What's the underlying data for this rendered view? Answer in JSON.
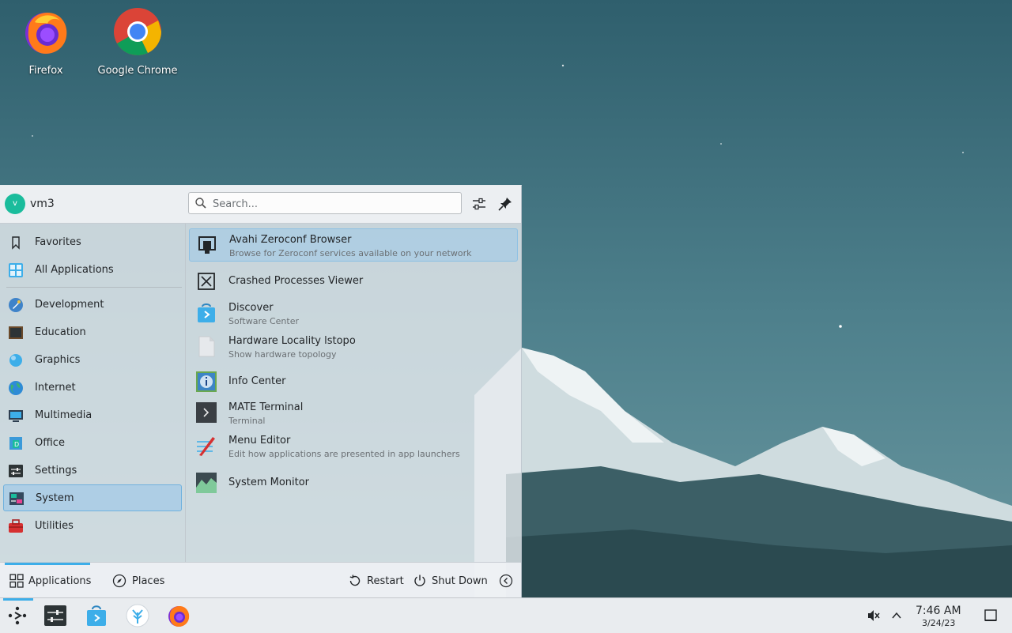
{
  "desktop": {
    "icons": [
      {
        "label": "Firefox"
      },
      {
        "label": "Google Chrome"
      }
    ]
  },
  "launcher": {
    "user": {
      "avatar_letter": "v",
      "name": "vm3"
    },
    "search": {
      "placeholder": "Search..."
    },
    "categories": [
      {
        "label": "Favorites",
        "icon": "bookmark-icon"
      },
      {
        "label": "All Applications",
        "icon": "grid-icon"
      },
      {
        "label": "Development",
        "icon": "development-icon"
      },
      {
        "label": "Education",
        "icon": "education-icon"
      },
      {
        "label": "Graphics",
        "icon": "graphics-icon"
      },
      {
        "label": "Internet",
        "icon": "internet-icon"
      },
      {
        "label": "Multimedia",
        "icon": "multimedia-icon"
      },
      {
        "label": "Office",
        "icon": "office-icon"
      },
      {
        "label": "Settings",
        "icon": "settings-icon"
      },
      {
        "label": "System",
        "icon": "system-icon"
      },
      {
        "label": "Utilities",
        "icon": "utilities-icon"
      }
    ],
    "selected_category": "System",
    "apps": [
      {
        "name": "Avahi Zeroconf Browser",
        "description": "Browse for Zeroconf services available on your network"
      },
      {
        "name": "Crashed Processes Viewer",
        "description": ""
      },
      {
        "name": "Discover",
        "description": "Software Center"
      },
      {
        "name": "Hardware Locality lstopo",
        "description": "Show hardware topology"
      },
      {
        "name": "Info Center",
        "description": ""
      },
      {
        "name": "MATE Terminal",
        "description": "Terminal"
      },
      {
        "name": "Menu Editor",
        "description": "Edit how applications are presented in app launchers"
      },
      {
        "name": "System Monitor",
        "description": ""
      }
    ],
    "footer": {
      "applications_label": "Applications",
      "places_label": "Places",
      "restart_label": "Restart",
      "shutdown_label": "Shut Down"
    }
  },
  "taskbar": {
    "clock": {
      "time": "7:46 AM",
      "date": "3/24/23"
    }
  },
  "colors": {
    "accent": "#3daee9",
    "selection": "#9cc8e8"
  }
}
